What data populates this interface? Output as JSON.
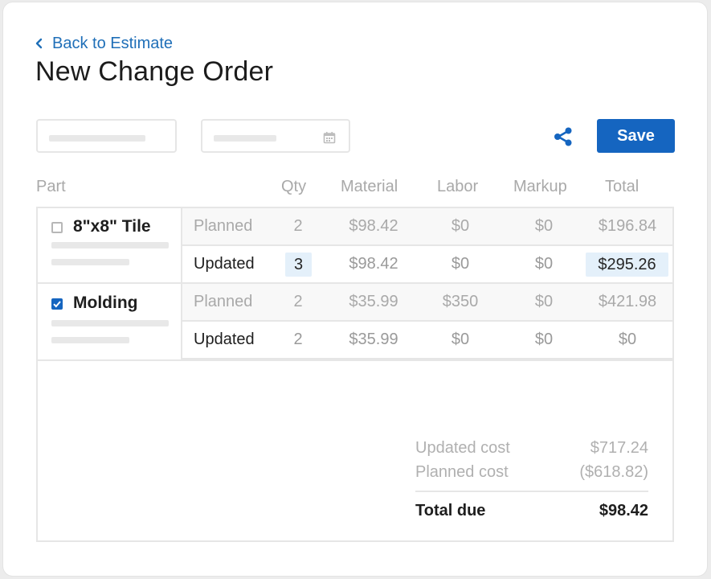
{
  "nav": {
    "back_label": "Back to Estimate"
  },
  "page": {
    "title": "New Change Order"
  },
  "toolbar": {
    "save_label": "Save",
    "share_icon": "share-icon",
    "calendar_icon": "calendar-icon"
  },
  "colors": {
    "accent": "#1565c0",
    "link": "#1f6fb8",
    "highlight": "#e4f0fa"
  },
  "columns": {
    "part": "Part",
    "qty": "Qty",
    "material": "Material",
    "labor": "Labor",
    "markup": "Markup",
    "total": "Total"
  },
  "parts": [
    {
      "name": "8\"x8\" Tile",
      "checked": false,
      "planned": {
        "label": "Planned",
        "qty": "2",
        "material": "$98.42",
        "labor": "$0",
        "markup": "$0",
        "total": "$196.84"
      },
      "updated": {
        "label": "Updated",
        "qty": "3",
        "material": "$98.42",
        "labor": "$0",
        "markup": "$0",
        "total": "$295.26"
      }
    },
    {
      "name": "Molding",
      "checked": true,
      "planned": {
        "label": "Planned",
        "qty": "2",
        "material": "$35.99",
        "labor": "$350",
        "markup": "$0",
        "total": "$421.98"
      },
      "updated": {
        "label": "Updated",
        "qty": "2",
        "material": "$35.99",
        "labor": "$0",
        "markup": "$0",
        "total": "$0"
      }
    }
  ],
  "summary": {
    "updated_cost_label": "Updated cost",
    "updated_cost_value": "$717.24",
    "planned_cost_label": "Planned cost",
    "planned_cost_value": "($618.82)",
    "total_due_label": "Total due",
    "total_due_value": "$98.42"
  }
}
